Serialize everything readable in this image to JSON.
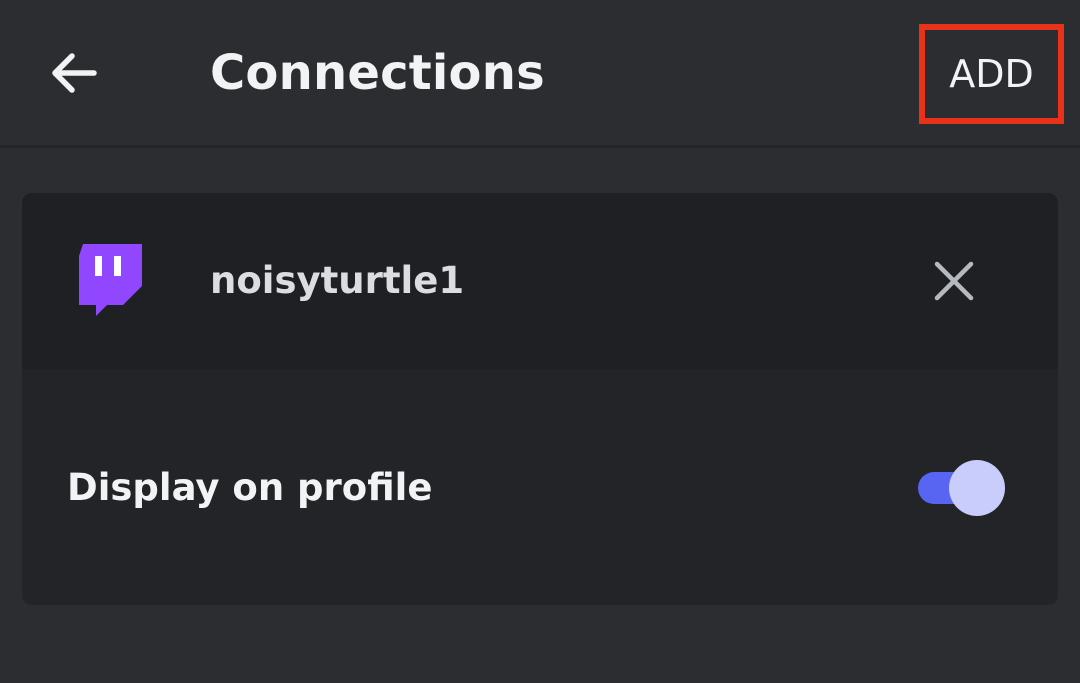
{
  "header": {
    "back_icon": "arrow-left-icon",
    "title": "Connections",
    "add_label": "ADD",
    "add_highlight_color": "#e8321a"
  },
  "connection": {
    "service_icon": "twitch-icon",
    "service_color": "#9146ff",
    "username": "noisyturtle1",
    "remove_icon": "close-icon",
    "display_label": "Display on profile",
    "display_on_profile": true,
    "toggle_color": "#5865f2"
  },
  "colors": {
    "background": "#2b2d31",
    "card_top": "#1f2023",
    "card_bottom": "#232428",
    "text": "#f2f3f5"
  }
}
